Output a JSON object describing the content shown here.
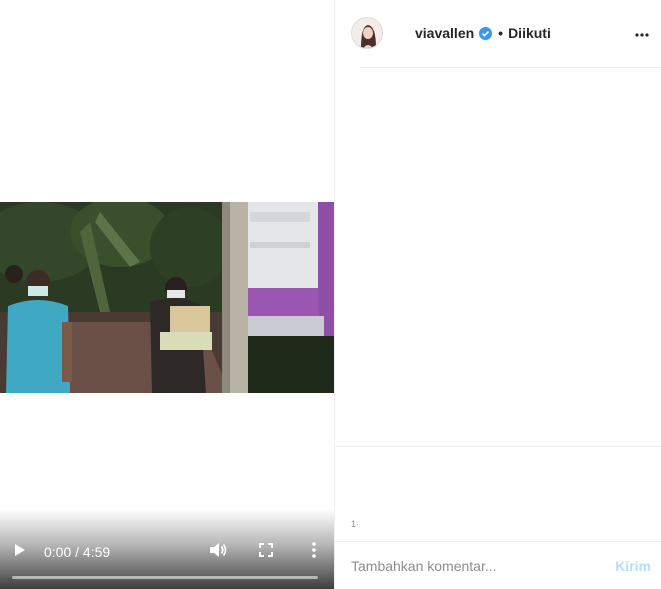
{
  "player": {
    "time_display": "0:00 / 4:59",
    "progress": 0,
    "icons": {
      "play": "play-icon",
      "volume": "volume-icon",
      "fullscreen": "fullscreen-icon",
      "more": "vertical-dots-icon"
    }
  },
  "post": {
    "username": "viavallen",
    "separator": "•",
    "follow_status": "Diikuti",
    "verified_color": "#3897f0",
    "icons": {
      "more_options": "horizontal-dots-icon",
      "verified": "verified-badge-icon"
    }
  },
  "caption_fragment": "1·",
  "comment_box": {
    "placeholder": "Tambahkan komentar...",
    "send_label": "Kirim",
    "send_color": "#b2dffc"
  }
}
